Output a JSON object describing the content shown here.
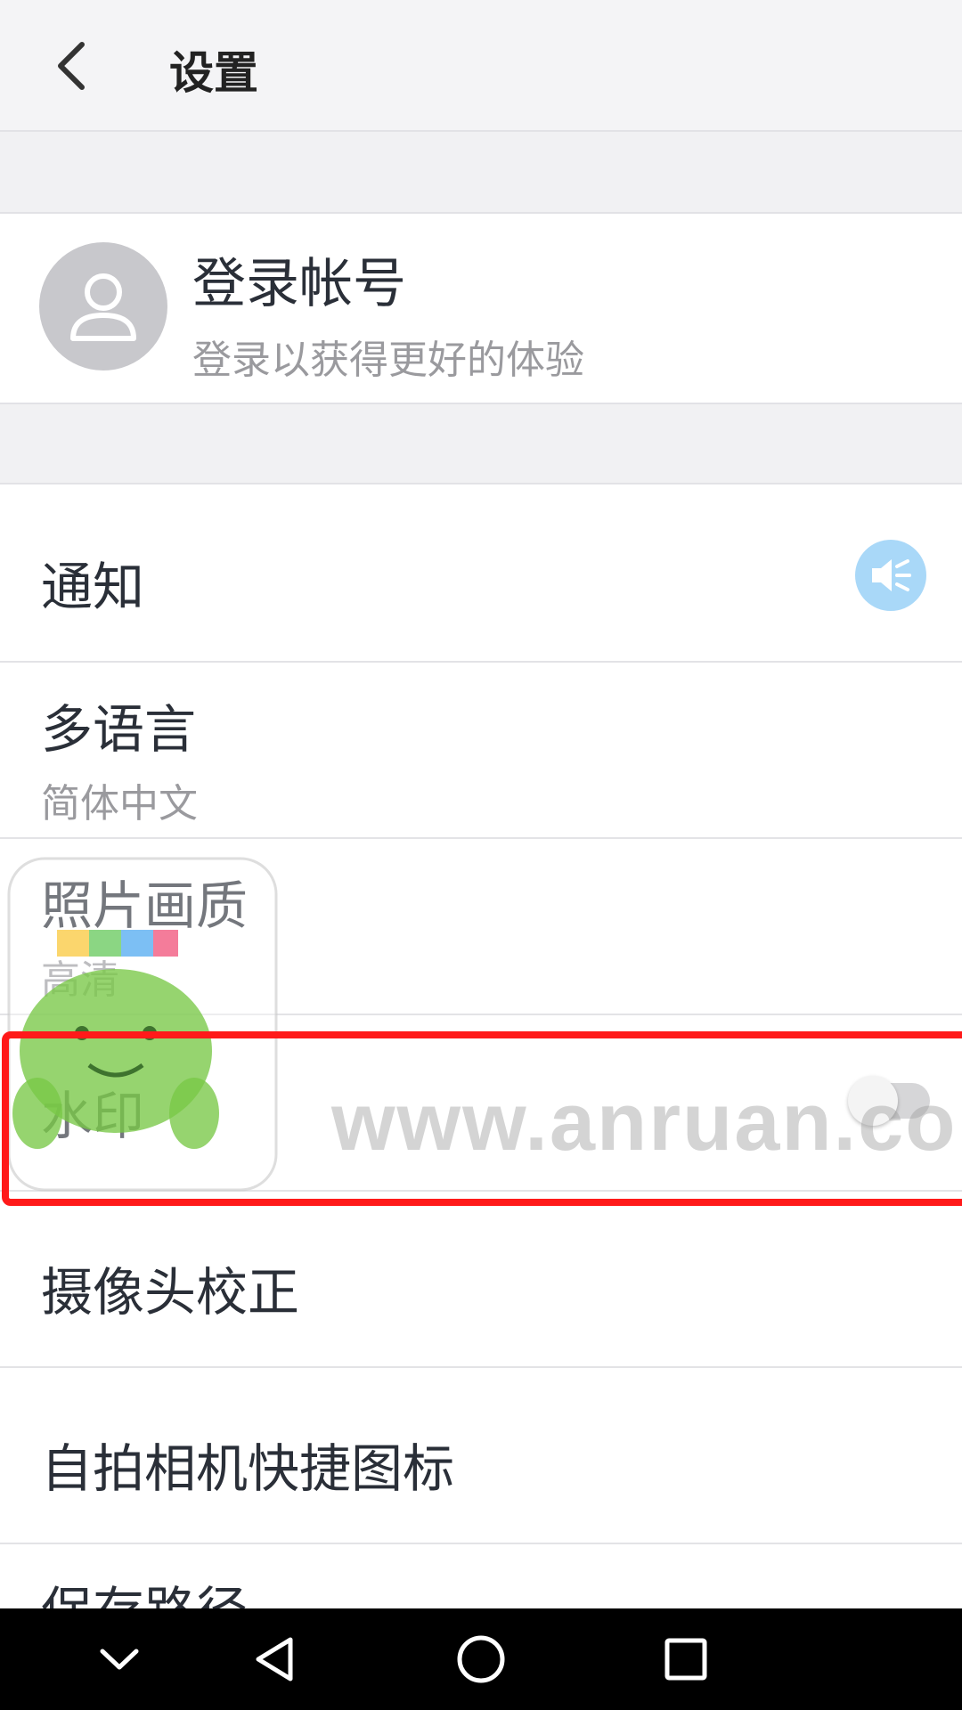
{
  "header": {
    "title": "设置"
  },
  "account": {
    "title": "登录帐号",
    "subtitle": "登录以获得更好的体验"
  },
  "settings": [
    {
      "label": "通知"
    },
    {
      "label": "多语言",
      "value": "简体中文"
    },
    {
      "label": "照片画质",
      "value": "高清"
    },
    {
      "label": "水印",
      "toggle_on": false
    },
    {
      "label": "摄像头校正"
    },
    {
      "label": "自拍相机快捷图标"
    },
    {
      "label": "保存路径"
    }
  ],
  "watermark": {
    "text": "www.anruan.com"
  },
  "colors": {
    "highlight": "#ff1a1a",
    "notify_icon_bg": "#a9d8f8",
    "header_bg": "#f4f4f6"
  }
}
